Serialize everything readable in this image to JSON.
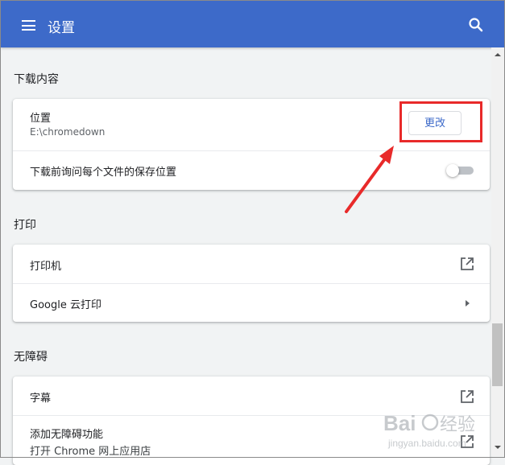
{
  "header": {
    "title": "设置"
  },
  "downloads": {
    "section_title": "下载内容",
    "location_label": "位置",
    "location_value": "E:\\chromedown",
    "change_button": "更改",
    "ask_label": "下载前询问每个文件的保存位置",
    "ask_enabled": false
  },
  "print": {
    "section_title": "打印",
    "printers_label": "打印机",
    "cloud_print_label": "Google 云打印"
  },
  "accessibility": {
    "section_title": "无障碍",
    "captions_label": "字幕",
    "add_features_label": "添加无障碍功能",
    "add_features_sublabel": "打开 Chrome 网上应用店"
  },
  "annotation_color": "#e82a2a",
  "accent_color": "#3d6ac9",
  "watermark": {
    "brand": "Baidu经验",
    "url": "jingyan.baidu.com"
  }
}
